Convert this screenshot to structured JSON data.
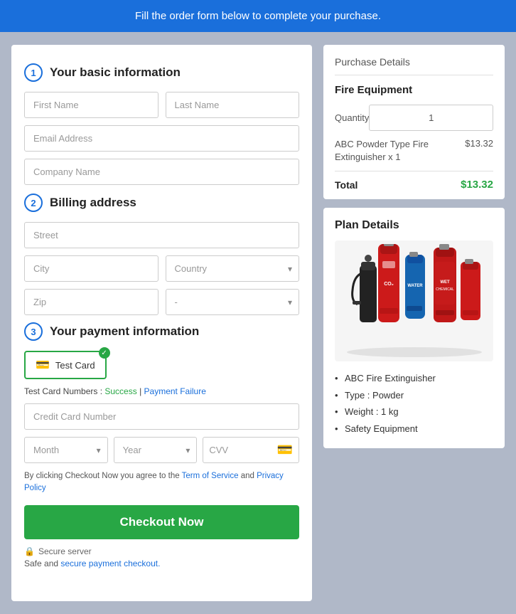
{
  "banner": {
    "text": "Fill the order form below to complete your purchase."
  },
  "basic_info": {
    "section_number": "1",
    "title": "Your basic information",
    "first_name_placeholder": "First Name",
    "last_name_placeholder": "Last Name",
    "email_placeholder": "Email Address",
    "company_placeholder": "Company Name"
  },
  "billing_address": {
    "section_number": "2",
    "title": "Billing address",
    "street_placeholder": "Street",
    "city_placeholder": "City",
    "country_placeholder": "Country",
    "zip_placeholder": "Zip",
    "state_placeholder": "-"
  },
  "payment": {
    "section_number": "3",
    "title": "Your payment information",
    "test_card_label": "Test Card",
    "test_card_numbers_label": "Test Card Numbers : ",
    "success_label": "Success",
    "pipe": " | ",
    "failure_label": "Payment Failure",
    "cc_placeholder": "Credit Card Number",
    "month_placeholder": "Month",
    "year_placeholder": "Year",
    "cvv_placeholder": "CVV",
    "terms_text": "By clicking Checkout Now you agree to the ",
    "terms_link": "Term of Service",
    "terms_and": " and ",
    "privacy_link": "Privacy Policy",
    "checkout_label": "Checkout Now",
    "secure_label": "Secure server",
    "safe_text": "Safe and ",
    "safe_link": "secure payment checkout."
  },
  "purchase_details": {
    "title": "Purchase Details",
    "equipment_title": "Fire Equipment",
    "quantity_label": "Quantity",
    "quantity_value": "1",
    "item_name": "ABC Powder Type Fire Extinguisher x 1",
    "item_price": "$13.32",
    "total_label": "Total",
    "total_price": "$13.32"
  },
  "plan_details": {
    "title": "Plan Details",
    "bullets": [
      "ABC Fire Extinguisher",
      "Type : Powder",
      "Weight : 1 kg",
      "Safety Equipment"
    ]
  }
}
